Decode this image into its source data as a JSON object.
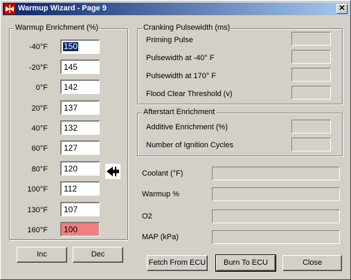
{
  "window": {
    "title": "Warmup Wizard - Page 9",
    "close_glyph": "✕"
  },
  "warmup": {
    "legend": "Warmup Enrichment (%)",
    "rows": [
      {
        "temp": "-40°F",
        "value": "150"
      },
      {
        "temp": "-20°F",
        "value": "145"
      },
      {
        "temp": "0°F",
        "value": "142"
      },
      {
        "temp": "20°F",
        "value": "137"
      },
      {
        "temp": "40°F",
        "value": "132"
      },
      {
        "temp": "60°F",
        "value": "127"
      },
      {
        "temp": "80°F",
        "value": "120"
      },
      {
        "temp": "100°F",
        "value": "112"
      },
      {
        "temp": "130°F",
        "value": "107"
      },
      {
        "temp": "160°F",
        "value": "100"
      }
    ],
    "inc_label": "Inc",
    "dec_label": "Dec"
  },
  "cranking": {
    "legend": "Cranking Pulsewidth (ms)",
    "priming_label": "Priming Pulse",
    "pw40_label": "Pulsewidth at -40° F",
    "pw170_label": "Pulsewidth at  170° F",
    "flood_label": "Flood Clear Threshold (v)"
  },
  "afterstart": {
    "legend": "Afterstart Enrichment",
    "additive_label": "Additive Enrichment (%)",
    "cycles_label": "Number of Ignition Cycles"
  },
  "readouts": {
    "coolant_label": "Coolant (°F)",
    "warmup_label": "Warmup %",
    "o2_label": "O2",
    "map_label": "MAP (kPa)"
  },
  "buttons": {
    "fetch_label": "Fetch From ECU",
    "burn_label": "Burn To ECU",
    "close_label": "Close"
  },
  "colors": {
    "titlebar_start": "#0a246a",
    "titlebar_end": "#a6caf0",
    "warning_field": "#f08080"
  },
  "icons": {
    "title_icon": "app-icon",
    "indicator": "left-arrow-icon"
  }
}
